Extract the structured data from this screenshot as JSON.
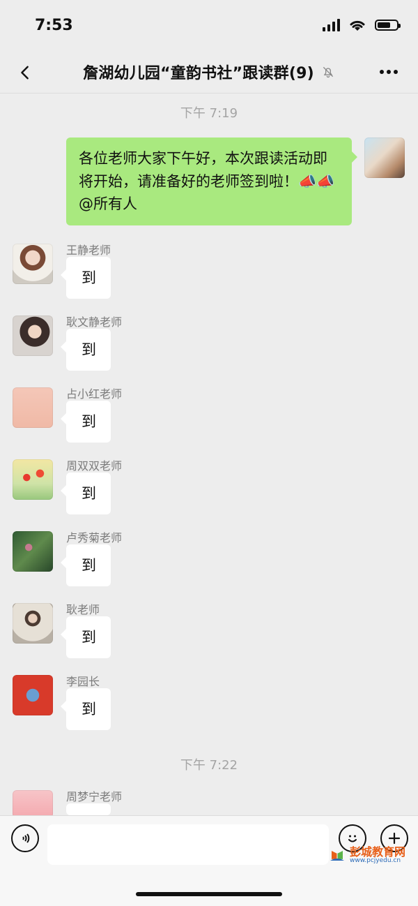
{
  "status": {
    "time": "7:53"
  },
  "nav": {
    "title": "詹湖幼儿园“童韵书社”跟读群(9)"
  },
  "timestamps": [
    "下午 7:19",
    "下午 7:22"
  ],
  "outgoing": {
    "text": "各位老师大家下午好，本次跟读活动即将开始，请准备好的老师签到啦！📣📣@所有人"
  },
  "messages": [
    {
      "sender": "王静老师",
      "text": "到"
    },
    {
      "sender": "耿文静老师",
      "text": "到"
    },
    {
      "sender": "占小红老师",
      "text": "到"
    },
    {
      "sender": "周双双老师",
      "text": "到"
    },
    {
      "sender": "卢秀菊老师",
      "text": "到"
    },
    {
      "sender": "耿老师",
      "text": "到"
    },
    {
      "sender": "李园长",
      "text": "到"
    }
  ],
  "partial_message": {
    "sender": "周梦宁老师"
  },
  "watermark": {
    "main": "彭城教育网",
    "url": "www.pcjyedu.cn"
  },
  "colors": {
    "background": "#ededed",
    "outgoing_bubble": "#a9e97f",
    "incoming_bubble": "#ffffff",
    "meta_text": "#a4a4a4"
  },
  "icons": {
    "back": "chevron-left-icon",
    "mute": "bell-slash-icon",
    "more": "more-dots-icon",
    "voice": "voice-icon",
    "emoji": "emoji-icon",
    "plus": "plus-icon"
  }
}
